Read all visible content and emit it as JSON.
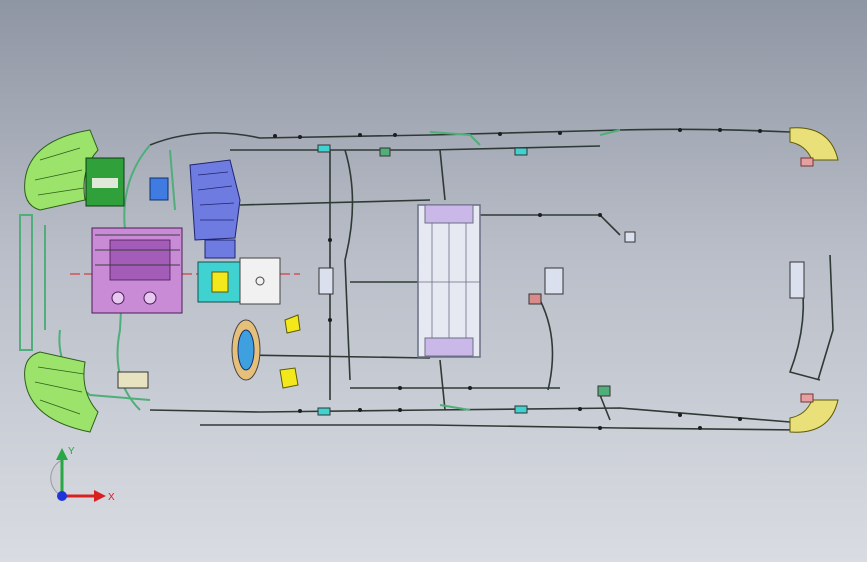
{
  "view": {
    "background_top": "#8f96a3",
    "background_bottom": "#d9dce2"
  },
  "colors": {
    "harness": "#2f3a35",
    "harness_green": "#4fae7a",
    "lamp": "#9be36a",
    "battery": "#e6e8f2",
    "battery_edge": "#6a6f86",
    "engine": "#c98ad6",
    "engine_blue": "#6e7be0",
    "cyan": "#3fd2d0",
    "yellow": "#f2e81c",
    "rear_lamp": "#e9e07a",
    "axis_x": "#d92020",
    "axis_y": "#27a845",
    "axis_z": "#2035d8"
  },
  "axes": {
    "x_label": "X",
    "y_label": "Y"
  }
}
